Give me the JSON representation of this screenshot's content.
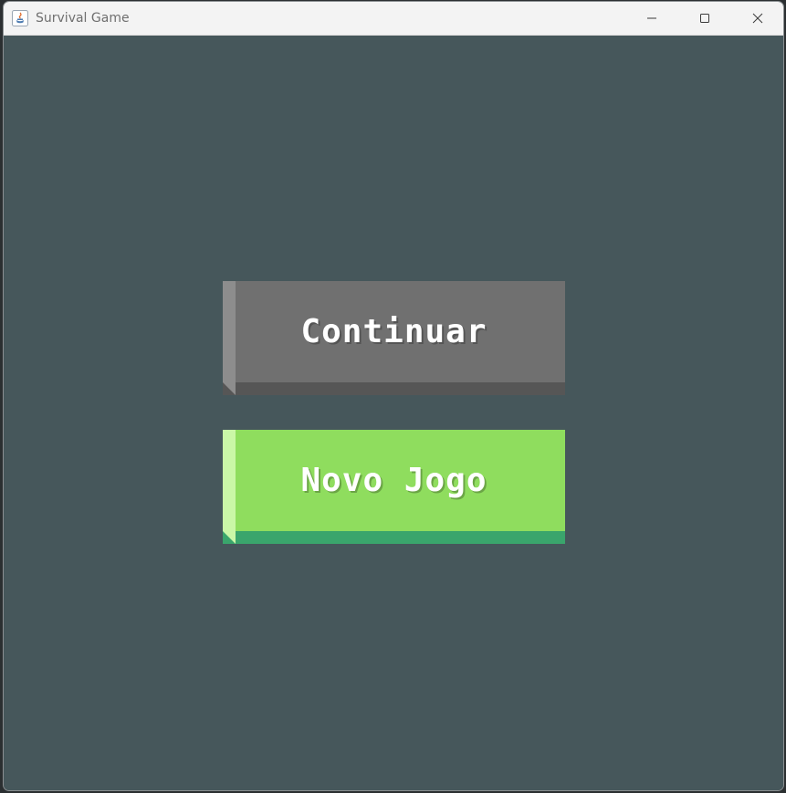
{
  "window": {
    "title": "Survival Game",
    "controls": {
      "minimize_icon": "minimize-icon",
      "maximize_icon": "maximize-icon",
      "close_icon": "close-icon"
    }
  },
  "menu": {
    "buttons": [
      {
        "label": "Continuar",
        "color": "#707070",
        "highlight": "#8d8d8d",
        "shadow": "#565656"
      },
      {
        "label": "Novo Jogo",
        "color": "#8fdd5e",
        "highlight": "#caf7a7",
        "shadow": "#3aa56c"
      }
    ]
  },
  "colors": {
    "background": "#46575b",
    "titlebar": "#f3f3f3",
    "title_text": "#6f6f6f"
  }
}
